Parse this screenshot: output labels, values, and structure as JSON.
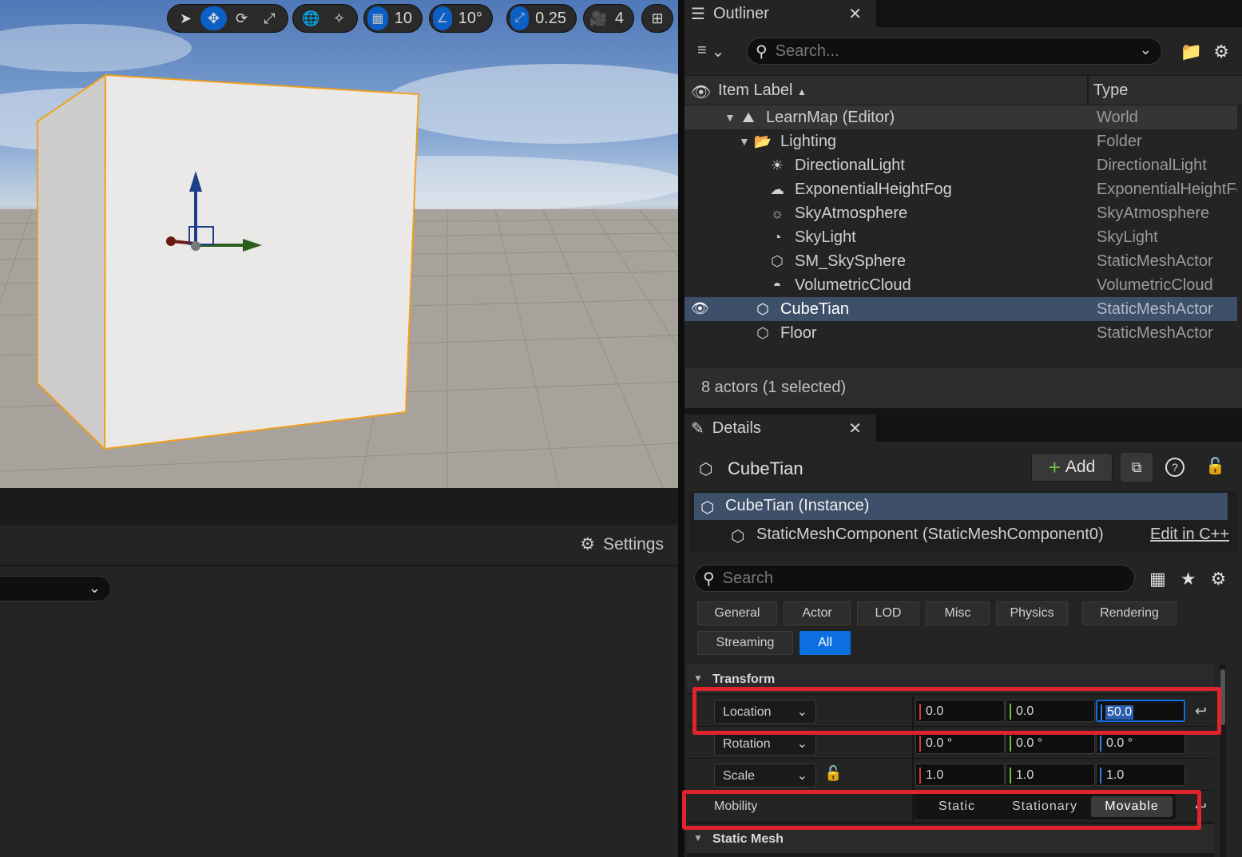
{
  "colors": {
    "accent": "#0b5fc6",
    "selection": "#3e4f6a",
    "highlight": "#e0232d",
    "x_axis": "#d33",
    "y_axis": "#6fbf44",
    "z_axis": "#3a7ee8",
    "cube_outline": "#f0a020"
  },
  "viewport_toolbar": {
    "tools": [
      "select-icon",
      "translate-icon",
      "rotate-icon",
      "scale-icon"
    ],
    "grid_snap": "10",
    "rotation_snap": "10°",
    "scale_snap": "0.25",
    "camera_speed": "4"
  },
  "left_panel": {
    "settings_label": "Settings"
  },
  "outliner": {
    "tab_title": "Outliner",
    "search_placeholder": "Search...",
    "col_label": "Item Label",
    "col_label_sort": "▲",
    "col_type": "Type",
    "rows": [
      {
        "name": "LearnMap (Editor)",
        "type": "World"
      },
      {
        "name": "Lighting",
        "type": "Folder"
      },
      {
        "name": "DirectionalLight",
        "type": "DirectionalLight"
      },
      {
        "name": "ExponentialHeightFog",
        "type": "ExponentialHeightFog"
      },
      {
        "name": "SkyAtmosphere",
        "type": "SkyAtmosphere"
      },
      {
        "name": "SkyLight",
        "type": "SkyLight"
      },
      {
        "name": "SM_SkySphere",
        "type": "StaticMeshActor"
      },
      {
        "name": "VolumetricCloud",
        "type": "VolumetricCloud"
      },
      {
        "name": "CubeTian",
        "type": "StaticMeshActor"
      },
      {
        "name": "Floor",
        "type": "StaticMeshActor"
      }
    ],
    "footer": "8 actors (1 selected)"
  },
  "details": {
    "tab_title": "Details",
    "actor_name": "CubeTian",
    "add_label": "Add",
    "instance_label": "CubeTian (Instance)",
    "component_label": "StaticMeshComponent (StaticMeshComponent0)",
    "edit_cpp": "Edit in C++",
    "search_placeholder": "Search",
    "categories": [
      "General",
      "Actor",
      "LOD",
      "Misc",
      "Physics",
      "Rendering",
      "Streaming",
      "All"
    ],
    "transform_section": "Transform",
    "location_label": "Location",
    "location": [
      "0.0",
      "0.0",
      "50.0"
    ],
    "rotation_label": "Rotation",
    "rotation": [
      "0.0 °",
      "0.0 °",
      "0.0 °"
    ],
    "scale_label": "Scale",
    "scale": [
      "1.0",
      "1.0",
      "1.0"
    ],
    "mobility_label": "Mobility",
    "mobility_options": [
      "Static",
      "Stationary",
      "Movable"
    ],
    "static_mesh_section": "Static Mesh"
  }
}
